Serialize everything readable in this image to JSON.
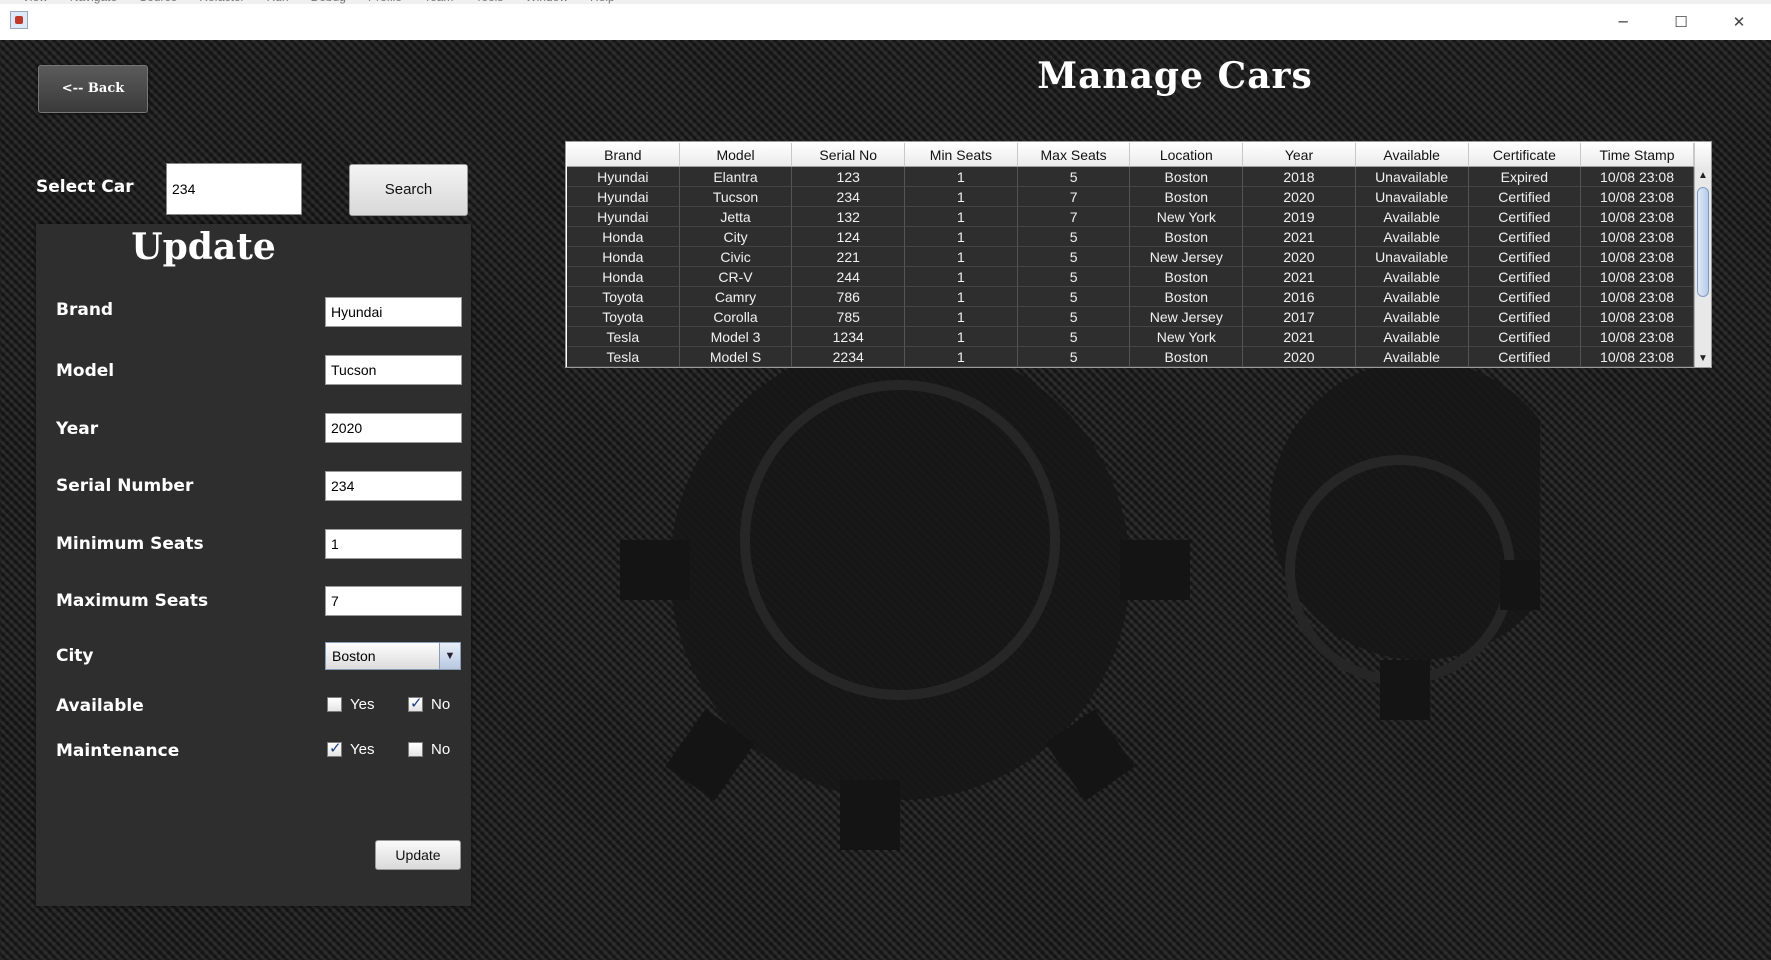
{
  "window": {
    "menu_items": [
      "View",
      "Navigate",
      "Source",
      "Refactor",
      "Run",
      "Debug",
      "Profile",
      "Team",
      "Tools",
      "Window",
      "Help"
    ],
    "minimize": "─",
    "maximize": "☐",
    "close": "✕"
  },
  "page": {
    "back_label": "<-- Back",
    "title": "Manage Cars"
  },
  "select": {
    "label": "Select Car",
    "value": "234",
    "search_label": "Search"
  },
  "form": {
    "title": "Update",
    "brand_label": "Brand",
    "brand_value": "Hyundai",
    "model_label": "Model",
    "model_value": "Tucson",
    "year_label": "Year",
    "year_value": "2020",
    "serial_label": "Serial Number",
    "serial_value": "234",
    "min_label": "Minimum Seats",
    "min_value": "1",
    "max_label": "Maximum Seats",
    "max_value": "7",
    "city_label": "City",
    "city_value": "Boston",
    "available_label": "Available",
    "available_yes": "Yes",
    "available_no": "No",
    "available_checked": "no",
    "maintenance_label": "Maintenance",
    "maintenance_yes": "Yes",
    "maintenance_no": "No",
    "maintenance_checked": "yes",
    "update_label": "Update"
  },
  "table": {
    "columns": [
      "Brand",
      "Model",
      "Serial No",
      "Min Seats",
      "Max Seats",
      "Location",
      "Year",
      "Available",
      "Certificate",
      "Time Stamp"
    ],
    "rows": [
      [
        "Hyundai",
        "Elantra",
        "123",
        "1",
        "5",
        "Boston",
        "2018",
        "Unavailable",
        "Expired",
        "10/08 23:08"
      ],
      [
        "Hyundai",
        "Tucson",
        "234",
        "1",
        "7",
        "Boston",
        "2020",
        "Unavailable",
        "Certified",
        "10/08 23:08"
      ],
      [
        "Hyundai",
        "Jetta",
        "132",
        "1",
        "7",
        "New York",
        "2019",
        "Available",
        "Certified",
        "10/08 23:08"
      ],
      [
        "Honda",
        "City",
        "124",
        "1",
        "5",
        "Boston",
        "2021",
        "Available",
        "Certified",
        "10/08 23:08"
      ],
      [
        "Honda",
        "Civic",
        "221",
        "1",
        "5",
        "New Jersey",
        "2020",
        "Unavailable",
        "Certified",
        "10/08 23:08"
      ],
      [
        "Honda",
        "CR-V",
        "244",
        "1",
        "5",
        "Boston",
        "2021",
        "Available",
        "Certified",
        "10/08 23:08"
      ],
      [
        "Toyota",
        "Camry",
        "786",
        "1",
        "5",
        "Boston",
        "2016",
        "Available",
        "Certified",
        "10/08 23:08"
      ],
      [
        "Toyota",
        "Corolla",
        "785",
        "1",
        "5",
        "New Jersey",
        "2017",
        "Available",
        "Certified",
        "10/08 23:08"
      ],
      [
        "Tesla",
        "Model 3",
        "1234",
        "1",
        "5",
        "New York",
        "2021",
        "Available",
        "Certified",
        "10/08 23:08"
      ],
      [
        "Tesla",
        "Model S",
        "2234",
        "1",
        "5",
        "Boston",
        "2020",
        "Available",
        "Certified",
        "10/08 23:08"
      ]
    ]
  },
  "icons": {
    "app": "java-app-icon",
    "dropdown": "chevron-down-icon",
    "scroll_up": "scroll-up-icon",
    "scroll_down": "scroll-down-icon"
  }
}
